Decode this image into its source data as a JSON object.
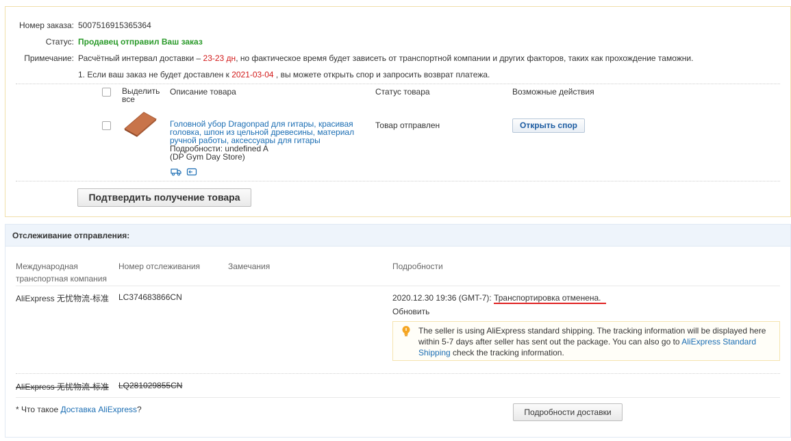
{
  "order": {
    "number_label": "Номер заказа:",
    "number_value": "5007516915365364",
    "status_label": "Статус:",
    "status_value": "Продавец отправил Ваш заказ",
    "note_label": "Примечание:",
    "note_prefix": "Расчётный интервал доставки – ",
    "note_days": "23-23 дн",
    "note_suffix": ", но фактическое время будет зависеть от транспортной компании и других факторов, таких как прохождение таможни.",
    "note2_prefix": "1. Если ваш заказ не будет доставлен к ",
    "note2_date": "2021-03-04",
    "note2_suffix": " , вы можете открыть спор и запросить возврат платежа.",
    "table_headers": {
      "select_all": "Выделить все",
      "description": "Описание товара",
      "status": "Статус товара",
      "actions": "Возможные действия"
    },
    "product": {
      "title": "Головной убор Dragonpad для гитары, красивая головка, шпон из цельной древесины, материал ручной работы, аксессуары для гитары",
      "details": "Подробности: undefined A",
      "store": "(DP Gym Day Store)",
      "status": "Товар отправлен",
      "action_label": "Открыть спор",
      "image_color": "#c8744a"
    },
    "confirm_label": "Подтвердить получение товара"
  },
  "tracking": {
    "title": "Отслеживание отправления:",
    "columns": {
      "carrier": "Международная транспортная компания",
      "tracking_no": "Номер отслеживания",
      "remarks": "Замечания",
      "details": "Подробности"
    },
    "row1": {
      "carrier": "AliExpress 无忧物流-标准",
      "tracking_no": "LC374683866CN",
      "event_time": "2020.12.30 19:36 (GMT-7):",
      "event_text": "Транспортировка отменена.",
      "refresh_label": "Обновить",
      "notice_prefix": "The seller is using AliExpress standard shipping. The tracking information will be displayed here within 5-7 days after seller has sent out the package. You can also go to ",
      "notice_link": "AliExpress Standard Shipping",
      "notice_suffix": " check the tracking information."
    },
    "row2": {
      "carrier": "AliExpress 无忧物流-标准",
      "tracking_no": "LQ281029855CN"
    },
    "footer_prefix": "* Что такое ",
    "footer_link": "Доставка AliExpress",
    "footer_suffix": "?",
    "delivery_details_label": "Подробности доставки"
  },
  "colors": {
    "accent_link": "#1a6db3",
    "status_green": "#2a9a2a",
    "warning_red": "#d21a1a",
    "panel_border": "#f1dfaa",
    "tracking_header_bg": "#eef4fb"
  },
  "icons": [
    "truck-icon",
    "message-icon",
    "lightbulb-icon"
  ]
}
